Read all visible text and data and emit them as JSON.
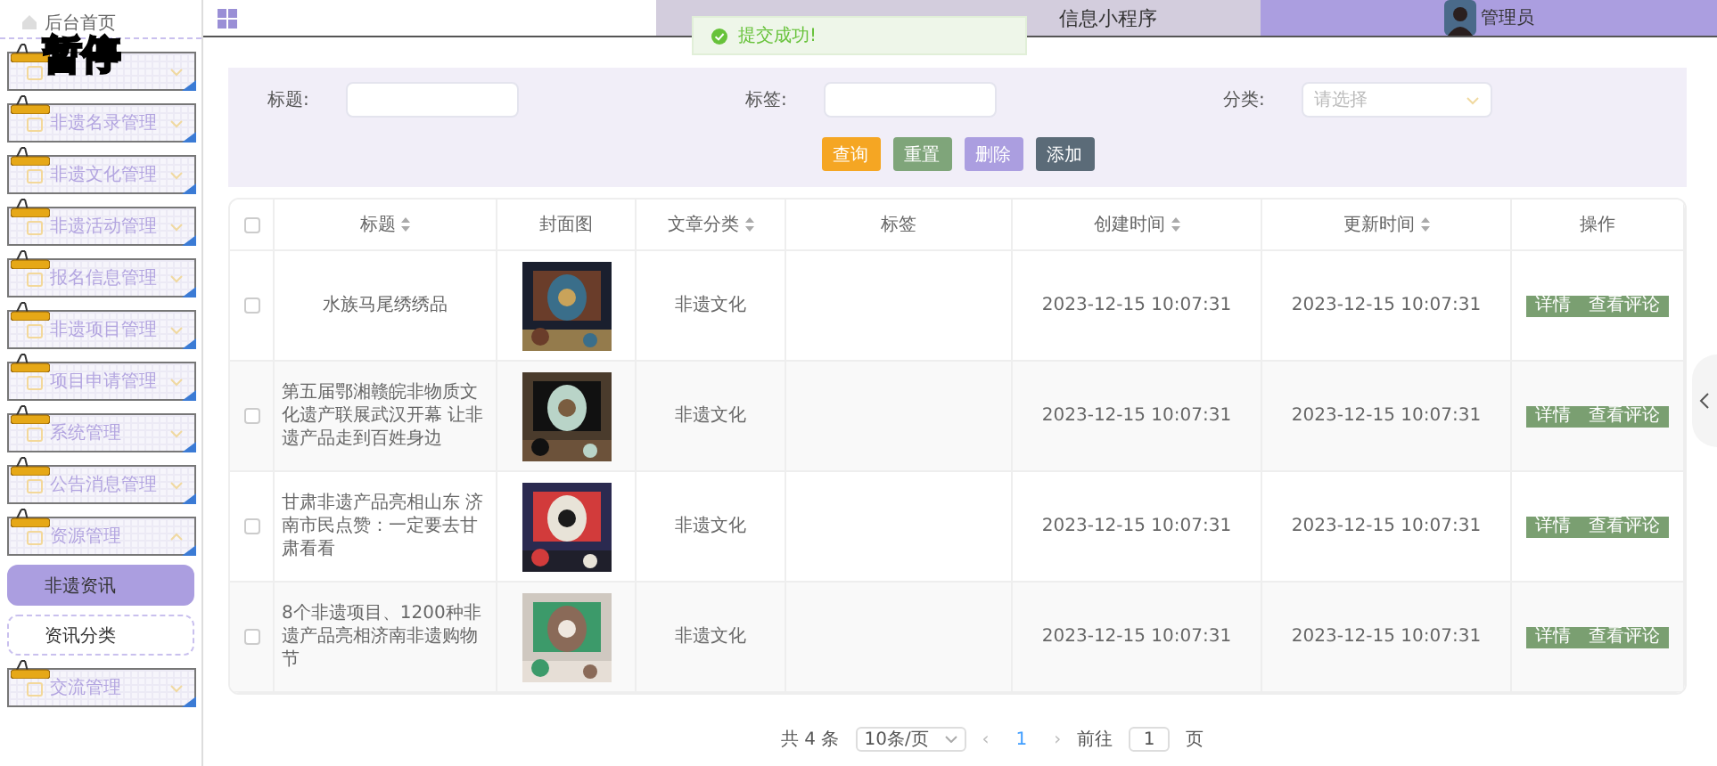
{
  "header": {
    "title": "信息小程序",
    "user": "管理员"
  },
  "toast": {
    "message": "提交成功!"
  },
  "pause_overlay": "暂停",
  "sidebar": {
    "items": [
      {
        "kind": "plain",
        "label": "后台首页"
      },
      {
        "kind": "folder",
        "expanded": false
      },
      {
        "kind": "folder",
        "label": "非遗名录管理",
        "expanded": false
      },
      {
        "kind": "folder",
        "label": "非遗文化管理",
        "expanded": false
      },
      {
        "kind": "folder",
        "label": "非遗活动管理",
        "expanded": false
      },
      {
        "kind": "folder",
        "label": "报名信息管理",
        "expanded": false
      },
      {
        "kind": "folder",
        "label": "非遗项目管理",
        "expanded": false
      },
      {
        "kind": "folder",
        "label": "项目申请管理",
        "expanded": false
      },
      {
        "kind": "folder",
        "label": "系统管理",
        "expanded": false
      },
      {
        "kind": "folder",
        "label": "公告消息管理",
        "expanded": false
      },
      {
        "kind": "folder",
        "label": "资源管理",
        "expanded": true,
        "children": [
          {
            "label": "非遗资讯",
            "selected": true
          },
          {
            "label": "资讯分类",
            "selected": false
          }
        ]
      },
      {
        "kind": "folder",
        "label": "交流管理",
        "expanded": false
      }
    ]
  },
  "filters": [
    {
      "kind": "text",
      "label": "标题:"
    },
    {
      "kind": "text",
      "label": "标签:"
    },
    {
      "kind": "select",
      "label": "分类:",
      "placeholder": "请选择"
    }
  ],
  "buttons": [
    {
      "label": "查询",
      "color": "#f5a623"
    },
    {
      "label": "重置",
      "color": "#7fa57a"
    },
    {
      "label": "删除",
      "color": "#ab9ee0"
    },
    {
      "label": "添加",
      "color": "#5b6b78"
    }
  ],
  "table": {
    "columns": [
      {
        "kind": "checkbox",
        "checked": false
      },
      {
        "kind": "text",
        "label": "标题",
        "sortable": true
      },
      {
        "kind": "text",
        "label": "封面图",
        "sortable": false
      },
      {
        "kind": "text",
        "label": "文章分类",
        "sortable": true
      },
      {
        "kind": "text",
        "label": "标签",
        "sortable": false
      },
      {
        "kind": "text",
        "label": "创建时间",
        "sortable": true
      },
      {
        "kind": "text",
        "label": "更新时间",
        "sortable": true
      },
      {
        "kind": "text",
        "label": "操作",
        "sortable": false
      }
    ],
    "rows": [
      {
        "checked": false,
        "title": "水族马尾绣绣品",
        "category": "非遗文化",
        "created": "2023-12-15 10:07:31",
        "updated": "2023-12-15 10:07:31",
        "actions": [
          "详情",
          "查看评论"
        ]
      },
      {
        "checked": false,
        "title": "第五届鄂湘赣皖非物质文化遗产联展武汉开幕 让非遗产品走到百姓身边",
        "category": "非遗文化",
        "created": "2023-12-15 10:07:31",
        "updated": "2023-12-15 10:07:31",
        "actions": [
          "详情",
          "查看评论"
        ]
      },
      {
        "checked": false,
        "title": "甘肃非遗产品亮相山东 济南市民点赞：一定要去甘肃看看",
        "category": "非遗文化",
        "created": "2023-12-15 10:07:31",
        "updated": "2023-12-15 10:07:31",
        "actions": [
          "详情",
          "查看评论"
        ]
      },
      {
        "checked": false,
        "title": "8个非遗项目、1200种非遗产品亮相济南非遗购物节",
        "category": "非遗文化",
        "created": "2023-12-15 10:07:31",
        "updated": "2023-12-15 10:07:31",
        "actions": [
          "详情",
          "查看评论"
        ]
      }
    ]
  },
  "pagination": {
    "total": "共 4 条",
    "page_size": "10条/页",
    "prev": "‹",
    "pages": [
      {
        "label": "1",
        "selected": true
      }
    ],
    "next": "›",
    "goto_label": "前往",
    "goto_value": "1",
    "page_unit": "页"
  }
}
